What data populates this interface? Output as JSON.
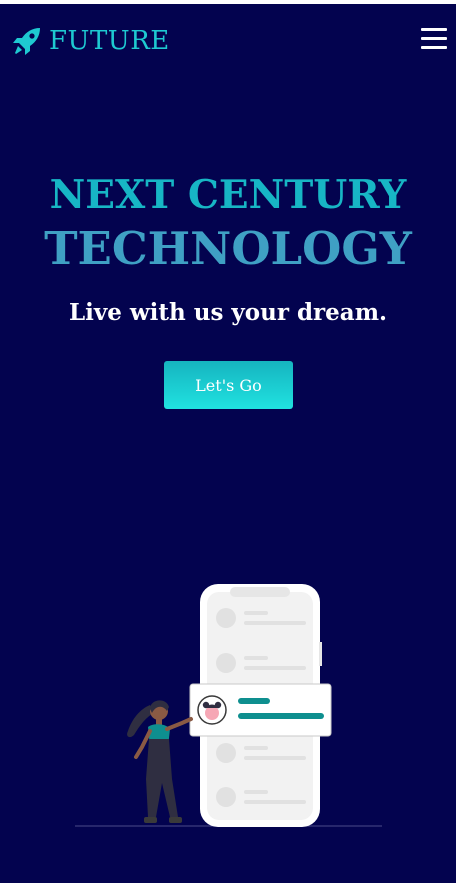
{
  "navbar": {
    "brand": "FUTURE",
    "brand_icon": "rocket-icon",
    "menu_icon": "hamburger-menu-icon"
  },
  "hero": {
    "line1": "NEXT CENTURY",
    "line2": "TECHNOLOGY",
    "tagline": "Live with us your dream.",
    "cta_label": "Let's Go"
  },
  "colors": {
    "background": "#03034f",
    "accent": "#1ec9d1",
    "heading_secondary": "#3fa0c4",
    "text": "#ffffff",
    "card_accent": "#0e8f8f"
  },
  "illustration": {
    "name": "woman-with-phone-illustration"
  }
}
